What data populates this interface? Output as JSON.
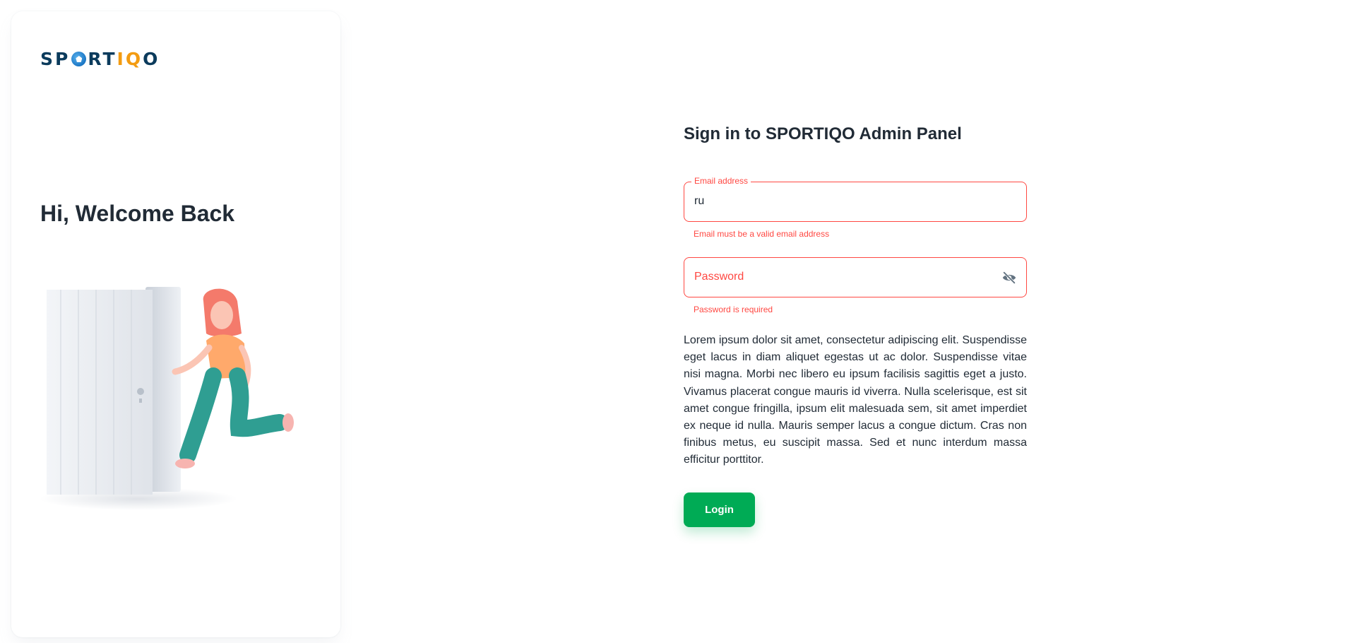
{
  "brand": {
    "logo_parts": [
      "SP",
      "RT",
      "IQ",
      "O"
    ],
    "logo_colors": {
      "dark": "#0b3b5c",
      "accent": "#f39c12",
      "ball": "#1b76c4"
    }
  },
  "side": {
    "welcome": "Hi, Welcome Back",
    "illustration": "person-leaving-door-illustration"
  },
  "form": {
    "title": "Sign in to SPORTIQO Admin Panel",
    "email": {
      "label": "Email address",
      "value": "ru",
      "error": "Email must be a valid email address"
    },
    "password": {
      "placeholder": "Password",
      "value": "",
      "error": "Password is required",
      "toggle_icon": "eye-off-icon"
    },
    "description": "Lorem ipsum dolor sit amet, consectetur adipiscing elit. Suspendisse eget lacus in diam aliquet egestas ut ac dolor. Suspendisse vitae nisi magna. Morbi nec libero eu ipsum facilisis sagittis eget a justo. Vivamus placerat congue mauris id viverra. Nulla scelerisque, est sit amet congue fringilla, ipsum elit malesuada sem, sit amet imperdiet ex neque id nulla. Mauris semper lacus a congue dictum. Cras non finibus metus, eu suscipit massa. Sed et nunc interdum massa efficitur porttitor.",
    "login_label": "Login"
  },
  "colors": {
    "primary": "#00AB55",
    "error": "#FF4842",
    "text": "#212B36"
  }
}
